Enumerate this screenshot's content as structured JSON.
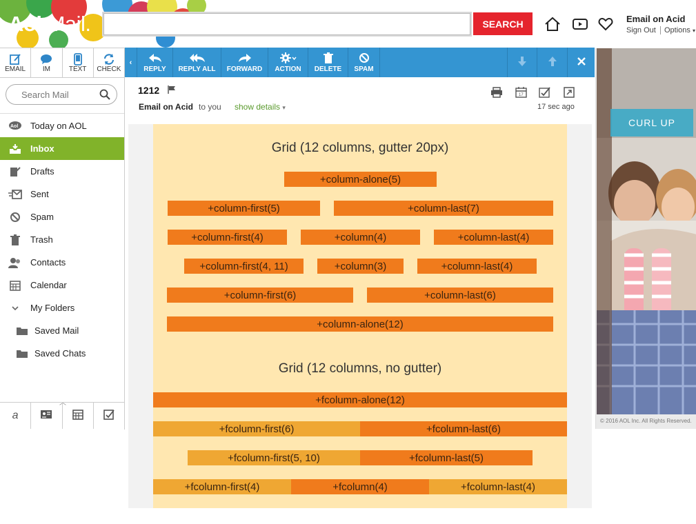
{
  "brand": {
    "logo_main": "Aol",
    "logo_sub": "Mail."
  },
  "search": {
    "button_label": "SEARCH",
    "placeholder": ""
  },
  "account": {
    "name": "Email on Acid",
    "sign_out": "Sign Out",
    "options": "Options"
  },
  "left_tools": [
    {
      "label": "EMAIL",
      "icon": "compose-icon"
    },
    {
      "label": "IM",
      "icon": "chat-bubble-icon"
    },
    {
      "label": "TEXT",
      "icon": "phone-icon"
    },
    {
      "label": "CHECK",
      "icon": "refresh-icon"
    }
  ],
  "sidebar": {
    "search_placeholder": "Search Mail",
    "items": [
      {
        "label": "Today on AOL",
        "icon": "aol-icon"
      },
      {
        "label": "Inbox",
        "icon": "inbox-icon",
        "active": true
      },
      {
        "label": "Drafts",
        "icon": "drafts-icon"
      },
      {
        "label": "Sent",
        "icon": "sent-icon"
      },
      {
        "label": "Spam",
        "icon": "spam-icon"
      },
      {
        "label": "Trash",
        "icon": "trash-icon"
      },
      {
        "label": "Contacts",
        "icon": "contacts-icon"
      },
      {
        "label": "Calendar",
        "icon": "calendar-icon"
      },
      {
        "label": "My Folders",
        "icon": "chevron-down-icon"
      },
      {
        "label": "Saved Mail",
        "icon": "folder-icon"
      },
      {
        "label": "Saved Chats",
        "icon": "folder-icon"
      }
    ]
  },
  "toolbar": {
    "reply": "REPLY",
    "reply_all": "REPLY ALL",
    "forward": "FORWARD",
    "action": "ACTION",
    "delete": "DELETE",
    "spam": "SPAM"
  },
  "message": {
    "subject": "1212",
    "sender": "Email on Acid",
    "recipient": "to you",
    "show_details": "show details",
    "time": "17 sec ago"
  },
  "email_content": {
    "gutter_title": "Grid (12 columns, gutter 20px)",
    "no_gutter_title": "Grid (12 columns, no gutter)",
    "gutter_rows": [
      [
        "+column-alone(5)"
      ],
      [
        "+column-first(5)",
        "+column-last(7)"
      ],
      [
        "+column-first(4)",
        "+column(4)",
        "+column-last(4)"
      ],
      [
        "+column-first(4, 11)",
        "+column(3)",
        "+column-last(4)"
      ],
      [
        "+column-first(6)",
        "+column-last(6)"
      ],
      [
        "+column-alone(12)"
      ]
    ],
    "no_gutter_rows": [
      [
        "+fcolumn-alone(12)"
      ],
      [
        "+fcolumn-first(6)",
        "+fcolumn-last(6)"
      ],
      [
        "+fcolumn-first(5, 10)",
        "+fcolumn-last(5)"
      ],
      [
        "+fcolumn-first(4)",
        "+fcolumn(4)",
        "+fcolumn-last(4)"
      ]
    ],
    "colors": {
      "canvas": "#ffe7b0",
      "orange": "#f07b1c",
      "light_orange": "#efa733"
    }
  },
  "ad": {
    "cta": "CURL UP",
    "copyright": "© 2016 AOL Inc. All Rights Reserved."
  },
  "colors": {
    "accent_blue": "#3495d2",
    "search_red": "#e5242d",
    "inbox_green": "#81b32a"
  }
}
